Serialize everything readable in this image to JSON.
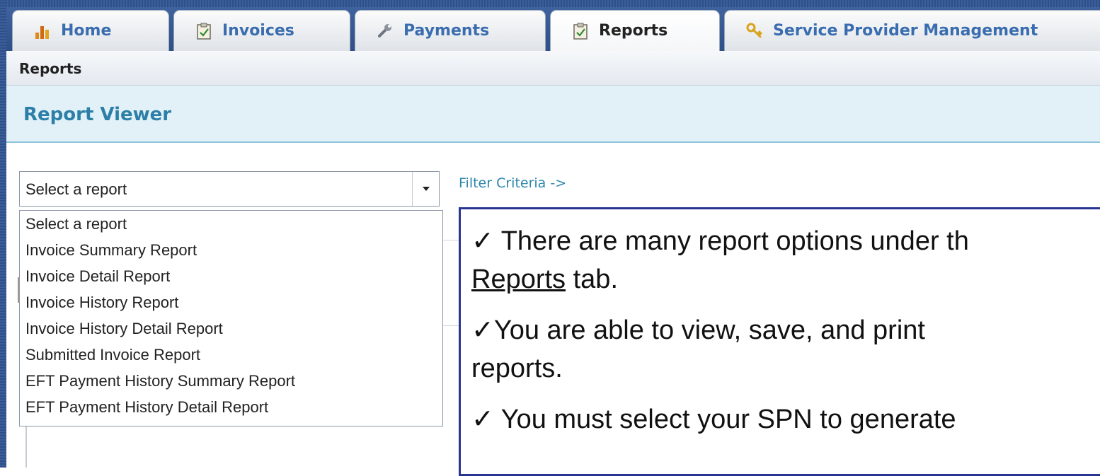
{
  "tabs": [
    {
      "label": "Home",
      "icon": "bar-chart-icon",
      "active": false
    },
    {
      "label": "Invoices",
      "icon": "clipboard-icon",
      "active": false
    },
    {
      "label": "Payments",
      "icon": "wrench-icon",
      "active": false
    },
    {
      "label": "Reports",
      "icon": "clipboard-icon",
      "active": true
    },
    {
      "label": "Service Provider Management",
      "icon": "key-icon",
      "active": false
    }
  ],
  "breadcrumb": {
    "label": "Reports"
  },
  "viewer": {
    "title": "Report Viewer"
  },
  "report_select": {
    "selected": "Select a report",
    "options": [
      "Select a report",
      "Invoice Summary Report",
      "Invoice Detail Report",
      "Invoice History Report",
      "Invoice History Detail Report",
      "Submitted Invoice Report",
      "EFT Payment History Summary Report",
      "EFT Payment History Detail Report"
    ]
  },
  "filter_link": "Filter Criteria ->",
  "callout": {
    "check": "✓",
    "line1": " There are many report options under th",
    "line2_link": "Reports",
    "line2_rest": " tab.",
    "line3": "You are able to view, save, and print",
    "line4": "reports.",
    "line5": " You must select your SPN to generate"
  },
  "colors": {
    "frame": "#2f4f86",
    "tab_text": "#3a6db0",
    "header_bg": "#e2f1f8",
    "header_title": "#2c7fa7",
    "callout_border": "#2a3592"
  }
}
